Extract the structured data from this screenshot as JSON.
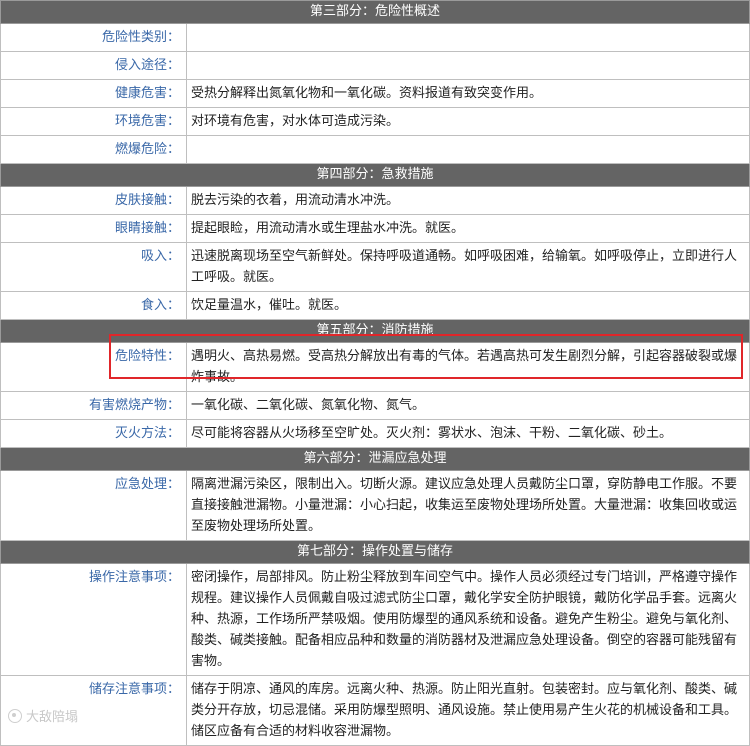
{
  "sections": {
    "s3": {
      "title": "第三部分：危险性概述",
      "rows": [
        {
          "label": "危险性类别：",
          "value": ""
        },
        {
          "label": "侵入途径：",
          "value": ""
        },
        {
          "label": "健康危害：",
          "value": "受热分解释出氮氧化物和一氧化碳。资料报道有致突变作用。"
        },
        {
          "label": "环境危害：",
          "value": "对环境有危害，对水体可造成污染。"
        },
        {
          "label": "燃爆危险：",
          "value": ""
        }
      ]
    },
    "s4": {
      "title": "第四部分：急救措施",
      "rows": [
        {
          "label": "皮肤接触：",
          "value": "脱去污染的衣着，用流动清水冲洗。"
        },
        {
          "label": "眼睛接触：",
          "value": "提起眼睑，用流动清水或生理盐水冲洗。就医。"
        },
        {
          "label": "吸入：",
          "value": "迅速脱离现场至空气新鲜处。保持呼吸道通畅。如呼吸困难，给输氧。如呼吸停止，立即进行人工呼吸。就医。"
        },
        {
          "label": "食入：",
          "value": "饮足量温水，催吐。就医。"
        }
      ]
    },
    "s5": {
      "title": "第五部分：消防措施",
      "rows": [
        {
          "label": "危险特性：",
          "value": "遇明火、高热易燃。受高热分解放出有毒的气体。若遇高热可发生剧烈分解，引起容器破裂或爆炸事故。"
        },
        {
          "label": "有害燃烧产物：",
          "value": "一氧化碳、二氧化碳、氮氧化物、氮气。"
        },
        {
          "label": "灭火方法：",
          "value": "尽可能将容器从火场移至空旷处。灭火剂：雾状水、泡沫、干粉、二氧化碳、砂土。"
        }
      ]
    },
    "s6": {
      "title": "第六部分：泄漏应急处理",
      "rows": [
        {
          "label": "应急处理：",
          "value": "隔离泄漏污染区，限制出入。切断火源。建议应急处理人员戴防尘口罩，穿防静电工作服。不要直接接触泄漏物。小量泄漏：小心扫起，收集运至废物处理场所处置。大量泄漏：收集回收或运至废物处理场所处置。"
        }
      ]
    },
    "s7": {
      "title": "第七部分：操作处置与储存",
      "rows": [
        {
          "label": "操作注意事项：",
          "value": "密闭操作，局部排风。防止粉尘释放到车间空气中。操作人员必须经过专门培训，严格遵守操作规程。建议操作人员佩戴自吸过滤式防尘口罩，戴化学安全防护眼镜，戴防化学品手套。远离火种、热源，工作场所严禁吸烟。使用防爆型的通风系统和设备。避免产生粉尘。避免与氧化剂、酸类、碱类接触。配备相应品种和数量的消防器材及泄漏应急处理设备。倒空的容器可能残留有害物。"
        },
        {
          "label": "储存注意事项：",
          "value": "储存于阴凉、通风的库房。远离火种、热源。防止阳光直射。包装密封。应与氧化剂、酸类、碱类分开存放，切忌混储。采用防爆型照明、通风设施。禁止使用易产生火花的机械设备和工具。储区应备有合适的材料收容泄漏物。"
        }
      ]
    }
  },
  "highlight": {
    "color": "#e0262a"
  },
  "watermark": {
    "text": "大敌陪塌",
    "icon": "watermark-logo-icon"
  }
}
